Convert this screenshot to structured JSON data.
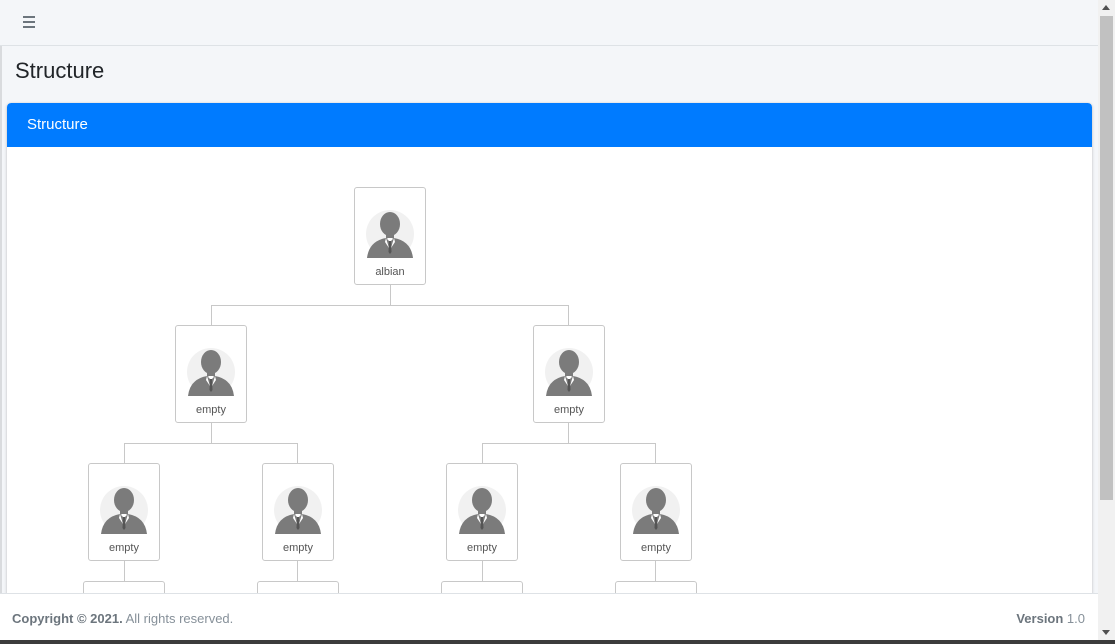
{
  "page": {
    "title": "Structure"
  },
  "card": {
    "header": "Structure"
  },
  "tree": {
    "root": {
      "name": "albian"
    },
    "level2": [
      {
        "name": "empty"
      },
      {
        "name": "empty"
      }
    ],
    "level3": [
      {
        "name": "empty"
      },
      {
        "name": "empty"
      },
      {
        "name": "empty"
      },
      {
        "name": "empty"
      }
    ]
  },
  "footer": {
    "copyright_strong": "Copyright © 2021.",
    "copyright_rest": " All rights reserved.",
    "version_label": "Version",
    "version_value": " 1.0"
  },
  "icons": {
    "menu": "hamburger-menu-icon",
    "avatar": "person-avatar-icon"
  },
  "colors": {
    "accent": "#007bff",
    "background": "#f4f6f9"
  }
}
